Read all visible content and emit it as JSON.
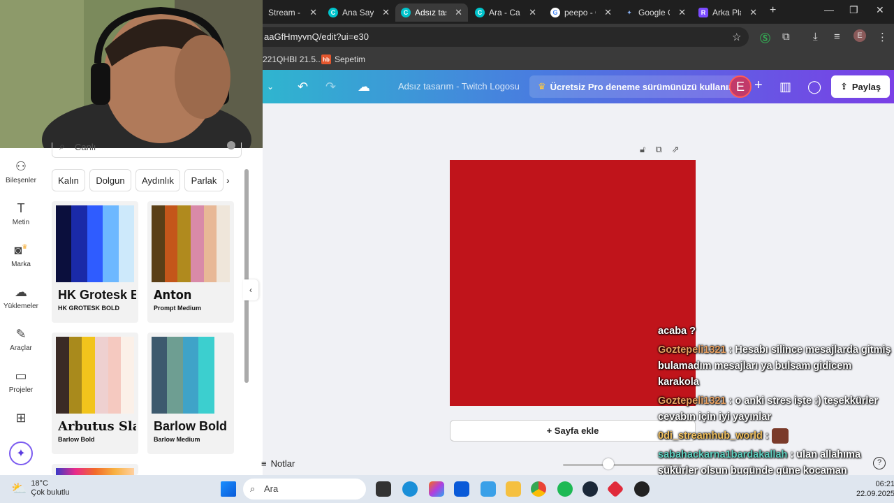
{
  "browser": {
    "tabs": [
      {
        "label": "Stream - K",
        "icon_color": "#ffffff",
        "active": false
      },
      {
        "label": "Ana Sayfa",
        "icon_color": "#00c4cc",
        "active": false
      },
      {
        "label": "Adsız tasarı",
        "icon_color": "#00c4cc",
        "active": true
      },
      {
        "label": "Ara - Canv",
        "icon_color": "#00c4cc",
        "active": false
      },
      {
        "label": "peepo - G",
        "icon_color": "#4285f4",
        "active": false
      },
      {
        "label": "Google Ge",
        "icon_color": "#8ab4f8",
        "active": false
      },
      {
        "label": "Arka Plan",
        "icon_color": "#7b4bff",
        "active": false
      }
    ],
    "new_tab": "+",
    "url": "aaGfHmyvnQ/edit?ui=e30",
    "bookmarks": [
      "221QHBI 21.5...",
      "Sepetim"
    ],
    "profile_letter": "E"
  },
  "canva": {
    "title": "Adsız tasarım - Twitch Logosu",
    "pro_label": "Ücretsiz Pro deneme sürümünüzü kullanın",
    "avatar_letter": "E",
    "share_label": "Paylaş",
    "colors": {
      "page": "#c0141b",
      "accent": "#7b5bf0"
    }
  },
  "leftnav": {
    "items": [
      {
        "label": "Bileşenler",
        "icon": "elements-icon"
      },
      {
        "label": "Metin",
        "icon": "text-icon"
      },
      {
        "label": "Marka",
        "icon": "brand-icon"
      },
      {
        "label": "Yüklemeler",
        "icon": "upload-icon"
      },
      {
        "label": "Araçlar",
        "icon": "tools-icon"
      },
      {
        "label": "Projeler",
        "icon": "folder-icon"
      }
    ]
  },
  "panel": {
    "search_value": "Canlı",
    "chips": [
      "Kalın",
      "Dolgun",
      "Aydınlık",
      "Parlak"
    ],
    "cards": [
      {
        "title": "HK Grotesk B",
        "sub": "HK GROTESK BOLD",
        "colors": [
          "#0b0f3d",
          "#1a2aa8",
          "#2f5cff",
          "#6db8ff",
          "#cde9fb"
        ]
      },
      {
        "title": "Anton",
        "sub": "Prompt Medium",
        "colors": [
          "#5a3f17",
          "#c4561a",
          "#b08a1e",
          "#d98aa8",
          "#e8b896",
          "#efe6da"
        ]
      },
      {
        "title": "Arbutus Slab",
        "sub": "Barlow Bold",
        "colors": [
          "#3a2a25",
          "#a98a1c",
          "#f2c41c",
          "#eed0d0",
          "#f5c9c0",
          "#fbf0e8"
        ]
      },
      {
        "title": "Barlow Bold",
        "sub": "Barlow Medium",
        "colors": [
          "#3d5a6e",
          "#6e9e92",
          "#3fa3c8",
          "#3ccfcf",
          "#f2f2f2"
        ]
      }
    ]
  },
  "canvas": {
    "add_page": "+ Sayfa ekle",
    "notes": "Notlar",
    "zoom": 0.38
  },
  "chat": [
    {
      "user": "",
      "text": "acaba ?"
    },
    {
      "user": "Goztepeli1321",
      "text": ": Hesabı silince mesajlarda gitmiş bulamadım mesajları ya bulsam gidicem karakola"
    },
    {
      "user": "Goztepeli1321",
      "text": ": o anki stres işte :) teşekkürler cevabın için iyi yayınlar"
    },
    {
      "user": "0di_streamhub_world",
      "text": ":"
    },
    {
      "user": "sabahackarna1bardakallah",
      "text": ": ulan allahıma şükürler olsun bugünde güne kocaman yarragimla basladim iyi yayinlar abi"
    }
  ],
  "taskbar": {
    "temp": "18°C",
    "weather": "Çok bulutlu",
    "search": "Ara",
    "time": "06:21",
    "date": "22.09.2025"
  }
}
